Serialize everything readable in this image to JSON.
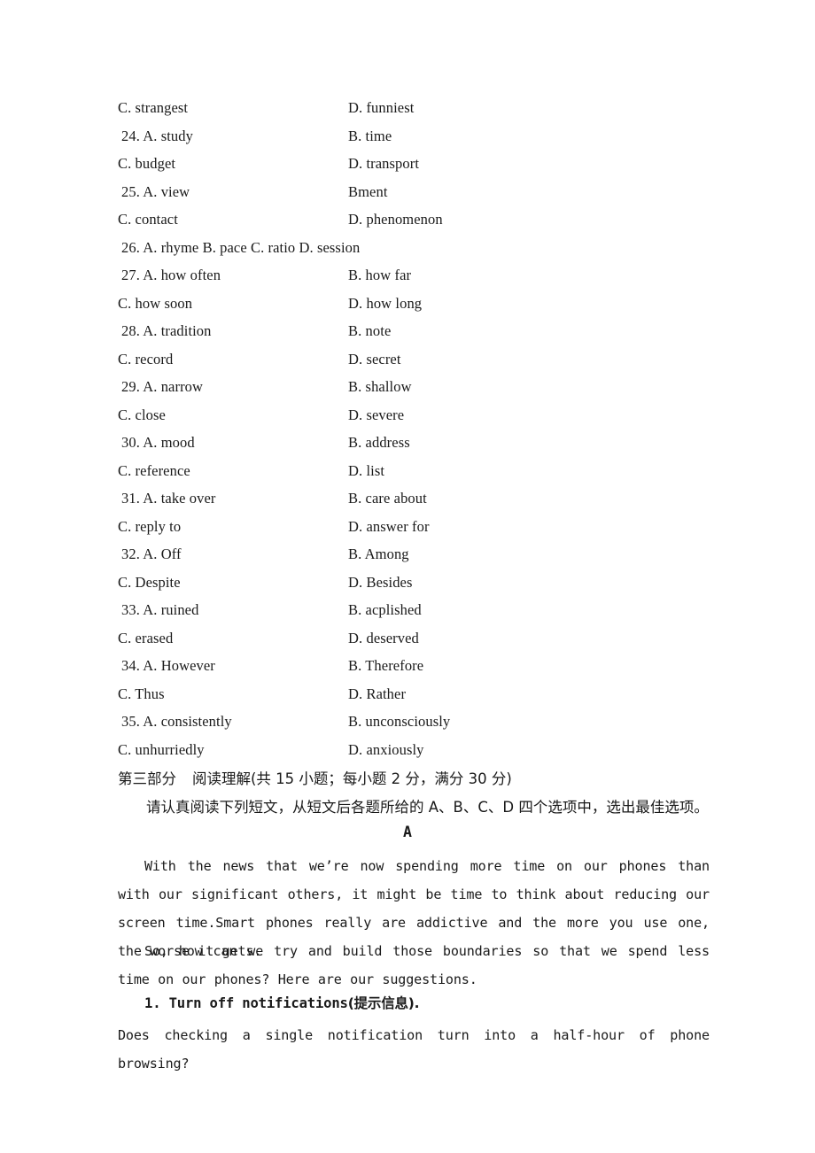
{
  "cloze": {
    "rows": [
      {
        "numbered": false,
        "a": "C. strangest",
        "b": "D. funniest"
      },
      {
        "numbered": true,
        "a": "24. A. study",
        "b": "B. time"
      },
      {
        "numbered": false,
        "a": "C. budget",
        "b": "D. transport"
      },
      {
        "numbered": true,
        "a": "25. A. view",
        "b": "Bment"
      },
      {
        "numbered": false,
        "a": "C. contact",
        "b": "D. phenomenon"
      },
      {
        "numbered": true,
        "quad": true,
        "a": "26. A. rhyme   B. pace   C. ratio   D. session",
        "b": ""
      },
      {
        "numbered": true,
        "a": "27. A. how often",
        "b": "B. how far"
      },
      {
        "numbered": false,
        "a": "C. how soon",
        "b": "D. how long"
      },
      {
        "numbered": true,
        "a": "28. A. tradition",
        "b": "B. note"
      },
      {
        "numbered": false,
        "a": "C. record",
        "b": "D. secret"
      },
      {
        "numbered": true,
        "a": "29. A. narrow",
        "b": "B. shallow"
      },
      {
        "numbered": false,
        "a": "C. close",
        "b": "D. severe"
      },
      {
        "numbered": true,
        "a": "30. A. mood",
        "b": "B. address"
      },
      {
        "numbered": false,
        "a": "C. reference",
        "b": "D. list"
      },
      {
        "numbered": true,
        "a": "31. A. take over",
        "b": "B. care about"
      },
      {
        "numbered": false,
        "a": "C. reply to",
        "b": "D. answer for"
      },
      {
        "numbered": true,
        "a": "32. A. Off",
        "b": "B. Among"
      },
      {
        "numbered": false,
        "a": "C. Despite",
        "b": "D. Besides"
      },
      {
        "numbered": true,
        "a": "33. A. ruined",
        "b": "B. acplished"
      },
      {
        "numbered": false,
        "a": "C. erased",
        "b": "D. deserved"
      },
      {
        "numbered": true,
        "a": "34. A. However",
        "b": "B. Therefore"
      },
      {
        "numbered": false,
        "a": "C. Thus",
        "b": "D. Rather"
      },
      {
        "numbered": true,
        "a": "35. A. consistently",
        "b": "B. unconsciously"
      },
      {
        "numbered": false,
        "a": "C. unhurriedly",
        "b": "D. anxiously"
      }
    ]
  },
  "section": {
    "heading_part": "第三部分",
    "heading_title": "阅读理解(共 15 小题；每小题 2 分，满分 30 分)",
    "instruction": "请认真阅读下列短文，从短文后各题所给的 A、B、C、D 四个选项中，选出最佳选项。",
    "passage_letter": "A"
  },
  "passage": {
    "para1": "With the news that we’re now spending more time on our phones than with our significant others, it might be time to think about reducing our screen time.Smart phones really are addictive and the more you use one, the worse it gets.",
    "para2": "So, how can we try and build those boundaries so that we spend less time on our phones? Here are our suggestions.",
    "subheading_en": "1. Turn off notifications",
    "subheading_cn": "(提示信息).",
    "para3": "Does checking a single notification turn into a half-hour of phone browsing?"
  }
}
